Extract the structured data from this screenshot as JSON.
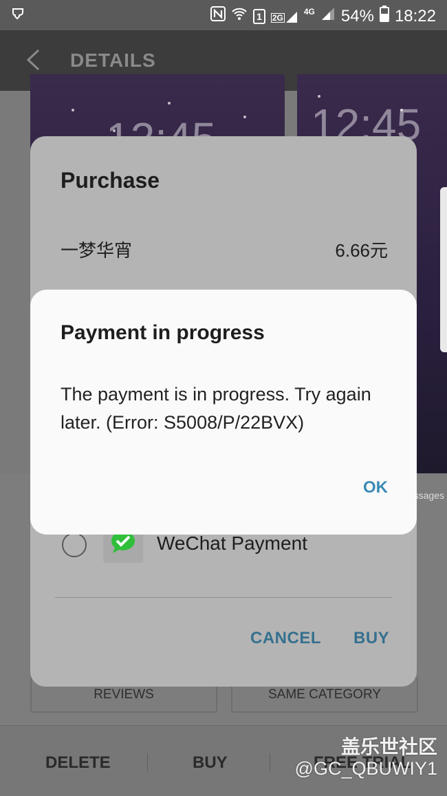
{
  "status_bar": {
    "battery": "54%",
    "time": "18:22",
    "sim_slot": "1",
    "network_2g": "2G",
    "network_4g": "4G",
    "icons": [
      "notification-icon",
      "nfc-icon",
      "wifi-icon",
      "signal-icon",
      "battery-icon"
    ]
  },
  "app_bar": {
    "title": "DETAILS"
  },
  "previews": {
    "clock": "12:45"
  },
  "side_label": "ssages",
  "tabs": {
    "reviews": "REVIEWS",
    "same_category": "SAME CATEGORY"
  },
  "bottom_bar": {
    "delete": "DELETE",
    "buy": "BUY",
    "free_trial": "FREE TRIAL"
  },
  "purchase_dialog": {
    "title": "Purchase",
    "item_name": "一梦华宵",
    "price": "6.66元",
    "payment_option": "WeChat Payment",
    "cancel": "CANCEL",
    "buy": "BUY"
  },
  "alert_dialog": {
    "title": "Payment in progress",
    "message": "The payment is in progress. Try again later. (Error: S5008/P/22BVX)",
    "ok": "OK"
  },
  "watermark": {
    "line1": "盖乐世社区",
    "line2": "@GC_QBUWIY1"
  },
  "colors": {
    "accent": "#3b8ab6",
    "wechat_green": "#2fbf3a",
    "dialog_bg": "#fafafa"
  }
}
